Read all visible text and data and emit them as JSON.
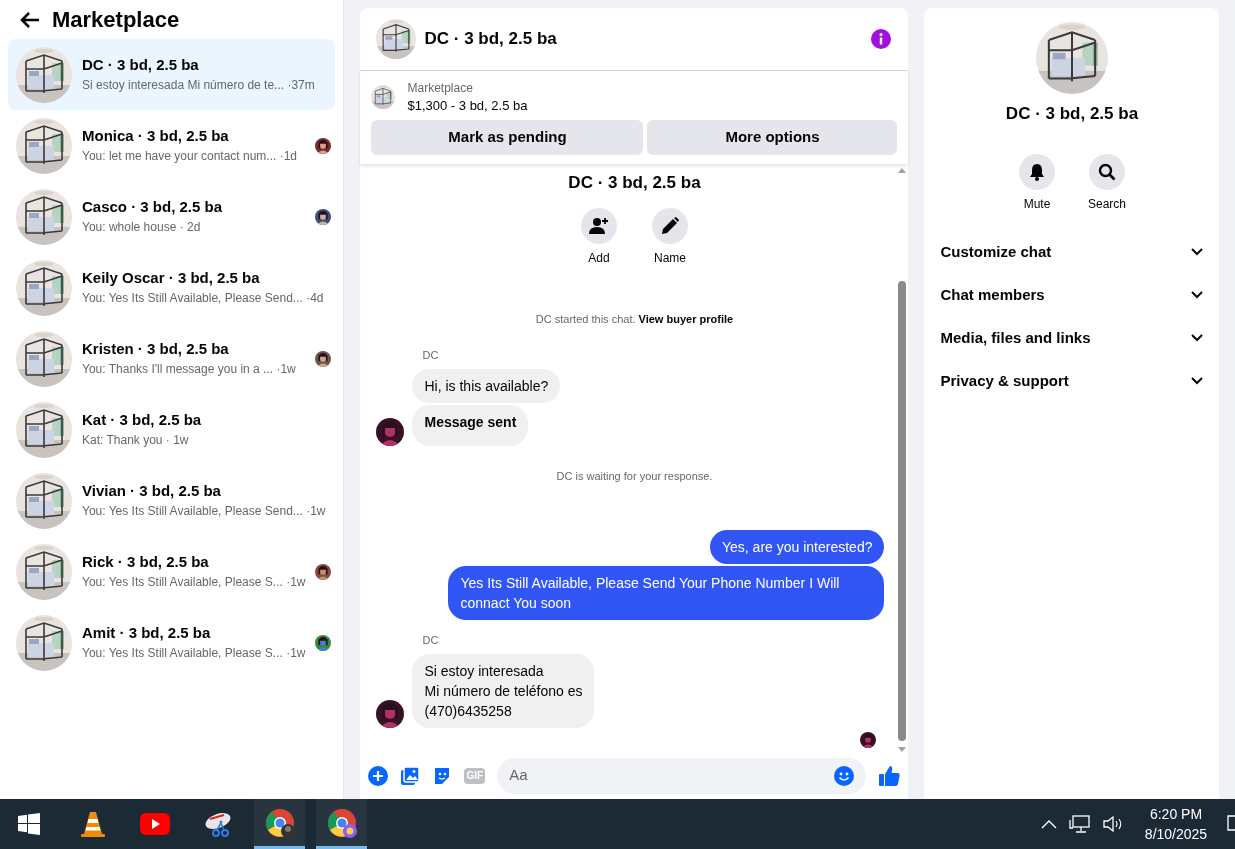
{
  "sidebar": {
    "title": "Marketplace",
    "conversations": [
      {
        "name": "DC · 3 bd, 2.5 ba",
        "preview": "Si estoy interesada Mi número de te... ·37m",
        "selected": true,
        "seen": false
      },
      {
        "name": "Monica · 3 bd, 2.5 ba",
        "preview": "You: let me have your contact num... ·1d",
        "selected": false,
        "seen": true
      },
      {
        "name": "Casco · 3 bd, 2.5 ba",
        "preview": "You: whole house · 2d",
        "selected": false,
        "seen": true
      },
      {
        "name": "Keily Oscar · 3 bd, 2.5 ba",
        "preview": "You: Yes Its Still Available, Please Send... ·4d",
        "selected": false,
        "seen": false
      },
      {
        "name": "Kristen · 3 bd, 2.5 ba",
        "preview": "You: Thanks I'll message you in a ... ·1w",
        "selected": false,
        "seen": true
      },
      {
        "name": "Kat · 3 bd, 2.5 ba",
        "preview": "Kat: Thank you · 1w",
        "selected": false,
        "seen": false
      },
      {
        "name": "Vivian · 3 bd, 2.5 ba",
        "preview": "You: Yes Its Still Available, Please Send... ·1w",
        "selected": false,
        "seen": false
      },
      {
        "name": "Rick · 3 bd, 2.5 ba",
        "preview": "You: Yes Its Still Available, Please S... ·1w",
        "selected": false,
        "seen": true
      },
      {
        "name": "Amit · 3 bd, 2.5 ba",
        "preview": "You: Yes Its Still Available, Please S... ·1w",
        "selected": false,
        "seen": true
      }
    ]
  },
  "chat": {
    "title": "DC · 3 bd, 2.5 ba",
    "listing": {
      "source": "Marketplace",
      "summary": "$1,300 - 3 bd, 2.5 ba",
      "buttons": [
        "Mark as pending",
        "More options"
      ]
    },
    "intro": {
      "title": "DC · 3 bd, 2.5 ba",
      "actions": [
        {
          "kind": "add",
          "label": "Add"
        },
        {
          "kind": "name",
          "label": "Name"
        }
      ]
    },
    "messages": [
      {
        "kind": "notice",
        "text": "DC started this chat.",
        "link": "View buyer profile"
      },
      {
        "kind": "incoming",
        "sender": "DC",
        "bubbles": [
          {
            "text": "Hi, is this available?",
            "bold": false
          },
          {
            "text": "Message sent",
            "bold": true
          }
        ]
      },
      {
        "kind": "notice",
        "text": "DC is waiting for your response."
      },
      {
        "kind": "outgoing",
        "bubbles": [
          {
            "text": "Yes, are you interested?",
            "bold": false
          },
          {
            "text": "Yes Its Still Available, Please Send Your Phone Number I Will connact You soon",
            "bold": false
          }
        ]
      },
      {
        "kind": "incoming",
        "sender": "DC",
        "bubbles": [
          {
            "text": "Si estoy interesada\nMi número de teléfono es\n(470)6435258",
            "bold": false
          }
        ]
      }
    ],
    "composer": {
      "gif": "GIF",
      "placeholder": "Aa"
    }
  },
  "details": {
    "title": "DC · 3 bd, 2.5 ba",
    "actions": [
      {
        "kind": "mute",
        "label": "Mute"
      },
      {
        "kind": "search",
        "label": "Search"
      }
    ],
    "sections": [
      {
        "label": "Customize chat",
        "expanded": false
      },
      {
        "label": "Chat members",
        "expanded": false
      },
      {
        "label": "Media, files and links",
        "expanded": false
      },
      {
        "label": "Privacy & support",
        "expanded": false
      }
    ]
  },
  "taskbar": {
    "time": "6:20 PM",
    "date": "8/10/2025"
  }
}
